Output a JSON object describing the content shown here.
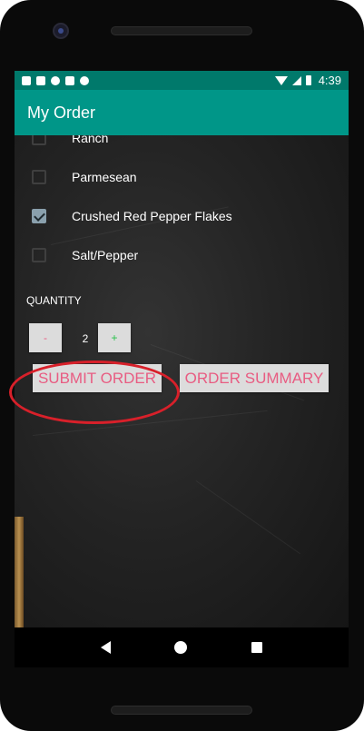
{
  "status_bar": {
    "time": "4:39",
    "icons_left": [
      "a-icon",
      "play-store-icon",
      "record-icon",
      "sd-card-icon",
      "cloud-icon"
    ],
    "icons_right": [
      "wifi-icon",
      "signal-icon",
      "battery-icon"
    ]
  },
  "app_bar": {
    "title": "My Order"
  },
  "toppings": [
    {
      "label": "Ranch",
      "checked": false
    },
    {
      "label": "Parmesean",
      "checked": false
    },
    {
      "label": "Crushed Red Pepper Flakes",
      "checked": true
    },
    {
      "label": "Salt/Pepper",
      "checked": false
    }
  ],
  "quantity": {
    "label": "QUANTITY",
    "minus_label": "-",
    "plus_label": "+",
    "value": "2"
  },
  "actions": {
    "submit_label": "SUBMIT ORDER",
    "summary_label": "ORDER SUMMARY"
  },
  "colors": {
    "accent": "#009688",
    "status_bar": "#00796b",
    "button_text": "#e85c82",
    "plus_text": "#27c24a",
    "annotation": "#d8202a"
  }
}
